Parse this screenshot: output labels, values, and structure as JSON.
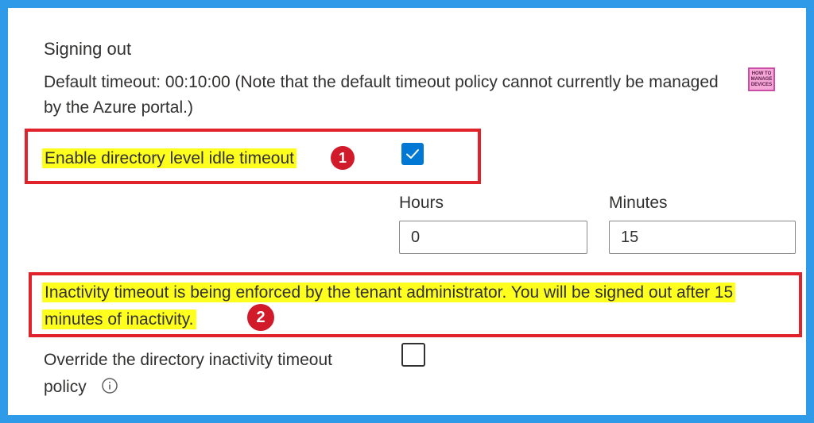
{
  "section": {
    "title": "Signing out",
    "description": "Default timeout: 00:10:00 (Note that the default timeout policy cannot currently be managed by the Azure portal.)"
  },
  "logo": {
    "line1": "HOW TO",
    "line2": "MANAGE",
    "line3": "DEVICES"
  },
  "enable_idle_timeout": {
    "label": "Enable directory level idle timeout",
    "checked": true,
    "badge": "1"
  },
  "hours": {
    "label": "Hours",
    "value": "0"
  },
  "minutes": {
    "label": "Minutes",
    "value": "15"
  },
  "notice": {
    "text": "Inactivity timeout is being enforced by the tenant administrator. You will be signed out after 15 minutes of inactivity.",
    "badge": "2"
  },
  "override": {
    "label_line1": "Override the directory inactivity timeout",
    "label_line2": "policy",
    "checked": false,
    "info_icon": "info-icon"
  },
  "colors": {
    "frame_border": "#2e9ae8",
    "callout_border": "#e0222b",
    "highlight": "#ffff1e",
    "badge": "#d11a2a",
    "checkbox_checked": "#0078d4"
  }
}
